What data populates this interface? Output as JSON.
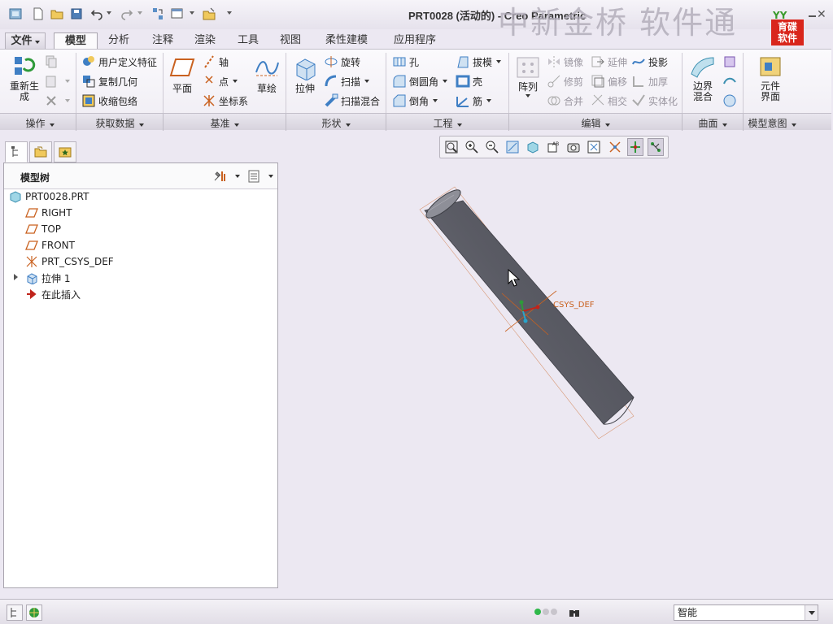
{
  "window": {
    "title": "PRT0028 (活动的) - Creo Parametric",
    "watermark": "中新金桥  软件通",
    "logo_text": "育碟\n软件"
  },
  "tabs": [
    "文件",
    "模型",
    "分析",
    "注释",
    "渲染",
    "工具",
    "视图",
    "柔性建模",
    "应用程序"
  ],
  "active_tab": "模型",
  "ribbon": {
    "regenerate": "重新生\n成",
    "user_defined_feature": "用户定义特征",
    "copy_geometry": "复制几何",
    "shrinkwrap": "收缩包络",
    "plane": "平面",
    "axis": "轴",
    "point": "点",
    "csys": "坐标系",
    "sketch": "草绘",
    "extrude": "拉伸",
    "revolve": "旋转",
    "sweep": "扫描",
    "swept_blend": "扫描混合",
    "hole": "孔",
    "round": "倒圆角",
    "chamfer": "倒角",
    "draft": "拔模",
    "shell": "壳",
    "rib": "筋",
    "pattern": "阵列",
    "mirror": "镜像",
    "trim": "修剪",
    "merge": "合并",
    "extend": "延伸",
    "offset": "偏移",
    "intersect": "相交",
    "project": "投影",
    "thicken": "加厚",
    "solidify": "实体化",
    "boundary_blend": "边界\n混合",
    "component_interface": "元件\n界面"
  },
  "groups": [
    "操作",
    "获取数据",
    "基准",
    "形状",
    "工程",
    "编辑",
    "曲面",
    "模型意图"
  ],
  "model_tree": {
    "title": "模型树",
    "items": [
      {
        "label": "PRT0028.PRT",
        "icon": "part-icon"
      },
      {
        "label": "RIGHT",
        "icon": "datum-plane-icon"
      },
      {
        "label": "TOP",
        "icon": "datum-plane-icon"
      },
      {
        "label": "FRONT",
        "icon": "datum-plane-icon"
      },
      {
        "label": "PRT_CSYS_DEF",
        "icon": "csys-icon"
      },
      {
        "label": "拉伸 1",
        "icon": "extrude-feature-icon"
      },
      {
        "label": "在此插入",
        "icon": "insert-here-arrow-icon"
      }
    ]
  },
  "viewport": {
    "csys_label": "CSYS_DEF",
    "model_color": "#5f606a"
  },
  "status": {
    "filter_value": "智能"
  }
}
